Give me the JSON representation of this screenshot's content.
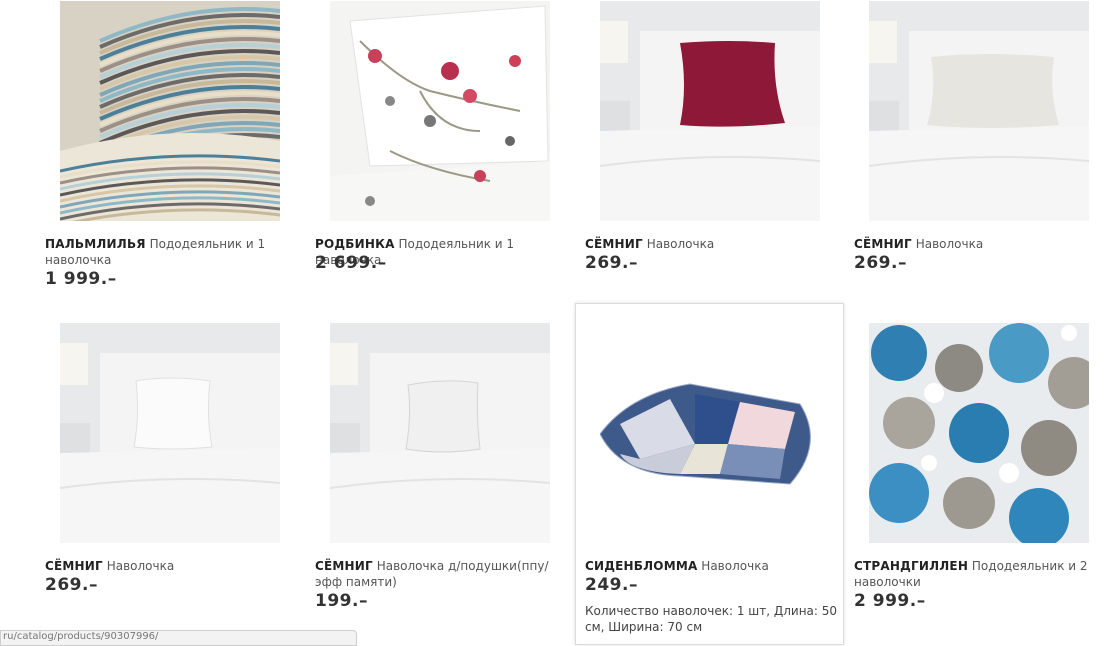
{
  "products": [
    {
      "name": "ПАЛЬМЛИЛЬЯ",
      "desc": "Пододеяльник и 1 наволочка",
      "price": "1 999.–",
      "image": "striped-bedding"
    },
    {
      "name": "РОДБИНКА",
      "desc": "Пододеяльник и 1 наволочка",
      "price": "2 699.–",
      "image": "floral-bedding"
    },
    {
      "name": "СЁМНИГ",
      "desc": "Наволочка",
      "price": "269.–",
      "image": "red-pillowcase"
    },
    {
      "name": "СЁМНИГ",
      "desc": "Наволочка",
      "price": "269.–",
      "image": "beige-pillowcase"
    },
    {
      "name": "СЁМНИГ",
      "desc": "Наволочка",
      "price": "269.–",
      "image": "white-pillowcase"
    },
    {
      "name": "СЁМНИГ",
      "desc": "Наволочка д/подушки(ппу/эфф памяти)",
      "price": "199.–",
      "image": "memory-pillowcase"
    },
    {
      "name": "СИДЕНБЛОММА",
      "desc": "Наволочка",
      "price": "249.–",
      "image": "patchwork-pillow",
      "attributes": "Количество наволочек: 1 шт, Длина: 50 см, Ширина: 70 см"
    },
    {
      "name": "СТРАНДГИЛЛЕН",
      "desc": "Пододеяльник и 2 наволочки",
      "price": "2 999.–",
      "image": "blue-floral-bedding"
    }
  ],
  "status_url": "ru/catalog/products/90307996/",
  "colors": {
    "text": "#333333",
    "price": "#333333",
    "border": "#dcdcdc"
  }
}
